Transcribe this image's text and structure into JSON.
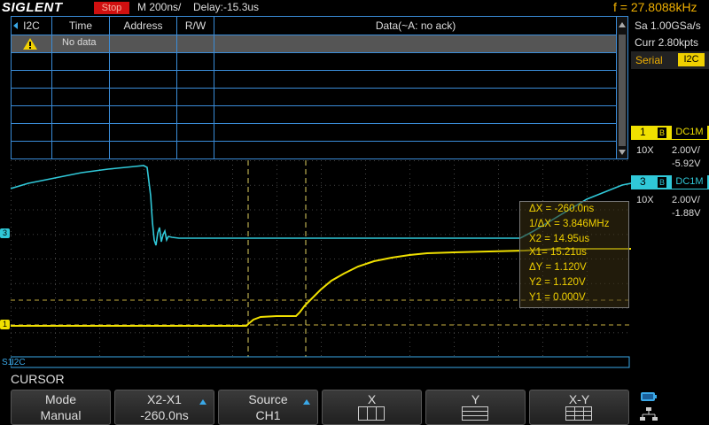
{
  "topbar": {
    "logo": "SIGLENT",
    "run_state": "Stop",
    "timebase": "M 200ns/",
    "delay": "Delay:-15.3us",
    "frequency": "f = 27.8088kHz"
  },
  "decode_table": {
    "protocol_label": "I2C",
    "columns": [
      "Time",
      "Address",
      "R/W",
      "Data(~A: no ack)"
    ],
    "rows": [
      {
        "warning": true,
        "time": "No data"
      }
    ]
  },
  "right_panel": {
    "sample_rate": "Sa 1.00GSa/s",
    "memory": "Curr 2.80kpts",
    "serial_label": "Serial",
    "serial_protocol": "I2C",
    "channels": [
      {
        "number": "1",
        "bw": "B",
        "coupling": "DC1M",
        "probe": "10X",
        "scale": "2.00V/",
        "offset": "-5.92V",
        "color": "#f0e000"
      },
      {
        "number": "3",
        "bw": "B",
        "coupling": "DC1M",
        "probe": "10X",
        "scale": "2.00V/",
        "offset": "-1.88V",
        "color": "#30c8d8"
      }
    ]
  },
  "cursor_info": {
    "dx": "ΔX = -260.0ns",
    "inv_dx": "1/ΔX = 3.846MHz",
    "x2": "X2 = 14.95us",
    "x1": "X1= 15.21us",
    "dy": "ΔY = 1.120V",
    "y2": "Y2 = 1.120V",
    "y1": "Y1 = 0.000V"
  },
  "waveform": {
    "ch1_marker": "1",
    "ch3_marker": "3",
    "bus_label": "I2C",
    "bus_marker": "S1"
  },
  "menu": {
    "title": "CURSOR",
    "buttons": [
      {
        "label": "Mode",
        "value": "Manual"
      },
      {
        "label": "X2-X1",
        "value": "-260.0ns"
      },
      {
        "label": "Source",
        "value": "CH1"
      },
      {
        "label": "X",
        "value": ""
      },
      {
        "label": "Y",
        "value": ""
      },
      {
        "label": "X-Y",
        "value": ""
      }
    ]
  },
  "colors": {
    "ch1": "#f0e000",
    "ch3": "#30c8d8",
    "grid": "#3a8cd8",
    "cursor": "#e0d060"
  }
}
